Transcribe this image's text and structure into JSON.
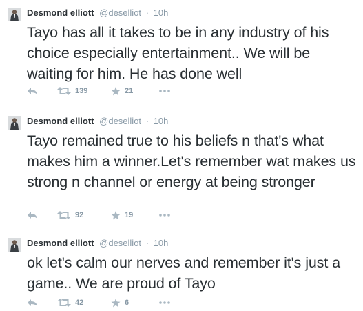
{
  "tweets": [
    {
      "author_name": "Desmond elliott",
      "handle": "@deselliot",
      "separator": "·",
      "time": "10h",
      "text": "Tayo has all it takes to be in any industry of his choice especially  entertainment.. We will be waiting for him.  He has done well",
      "retweets": "139",
      "favorites": "21"
    },
    {
      "author_name": "Desmond elliott",
      "handle": "@deselliot",
      "separator": "·",
      "time": "10h",
      "text": "Tayo remained true to his  beliefs n that's what makes him a winner.Let's remember wat makes us strong n channel or energy at being stronger",
      "retweets": "92",
      "favorites": "19"
    },
    {
      "author_name": "Desmond elliott",
      "handle": "@deselliot",
      "separator": "·",
      "time": "10h",
      "text": "ok let's calm our nerves and remember it's just a game.. We are proud of Tayo",
      "retweets": "42",
      "favorites": "6"
    }
  ],
  "icons": {
    "reply": "reply-icon",
    "retweet": "retweet-icon",
    "favorite": "star-icon",
    "more": "more-dots-icon"
  },
  "colors": {
    "text": "#292f33",
    "meta": "#8899a6",
    "icon": "#aab8c2",
    "divider": "#e1e8ed"
  }
}
